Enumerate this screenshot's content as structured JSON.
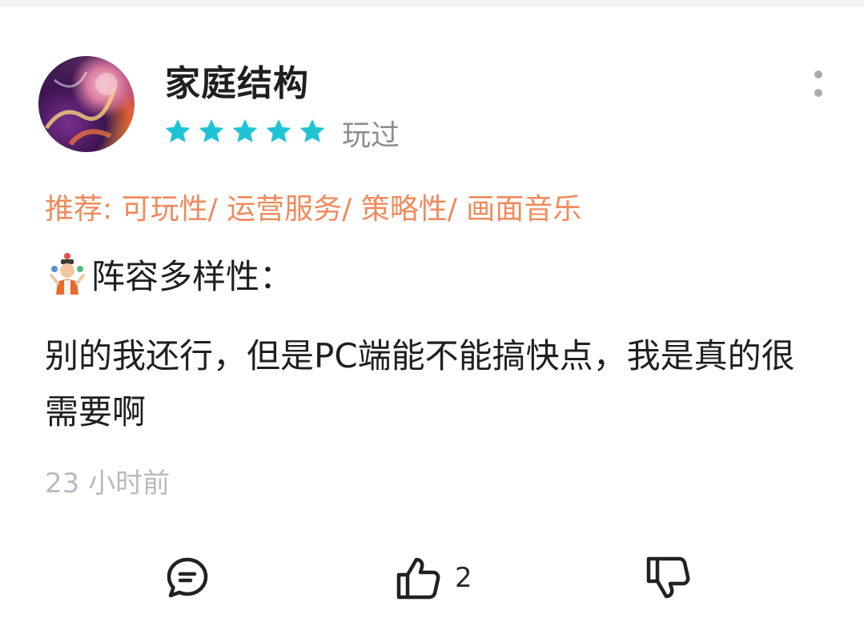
{
  "review": {
    "username": "家庭结构",
    "rating": 5,
    "rating_max": 5,
    "status": "玩过",
    "recommend": "推荐: 可玩性/ 运营服务/ 策略性/ 画面音乐",
    "heading": "阵容多样性：",
    "heading_emoji": "juggler-emoji",
    "body": "别的我还行，但是PC端能不能搞快点，我是真的很需要啊",
    "time": "23 小时前"
  },
  "actions": {
    "comment_icon": "comment-icon",
    "like_icon": "thumbs-up-icon",
    "like_count": "2",
    "dislike_icon": "thumbs-down-icon"
  },
  "colors": {
    "star": "#1fc4d4",
    "recommend": "#f08a5d",
    "muted": "#8a8f96",
    "timestamp": "#b7bbc1",
    "text": "#1f1f1f"
  }
}
